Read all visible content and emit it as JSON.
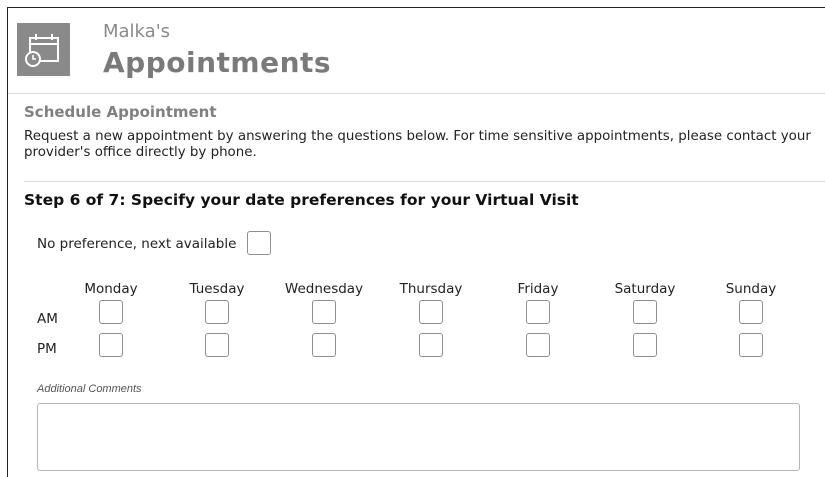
{
  "header": {
    "owner": "Malka's",
    "title": "Appointments",
    "logo_icon": "calendar-clock-icon"
  },
  "section": {
    "title": "Schedule Appointment",
    "intro": "Request a new appointment by answering the questions below. For time sensitive appointments, please contact your provider's office directly by phone."
  },
  "step": {
    "title": "Step 6 of 7: Specify your date preferences for your Virtual Visit"
  },
  "no_preference": {
    "label": "No preference, next available",
    "checked": false
  },
  "schedule": {
    "days": [
      "Monday",
      "Tuesday",
      "Wednesday",
      "Thursday",
      "Friday",
      "Saturday",
      "Sunday"
    ],
    "rows": [
      "AM",
      "PM"
    ]
  },
  "comments": {
    "label": "Additional Comments",
    "value": ""
  },
  "colors": {
    "logo_bg": "#8a8a8a",
    "title_gray": "#7a7a7a",
    "divider": "#d9d9d9"
  }
}
